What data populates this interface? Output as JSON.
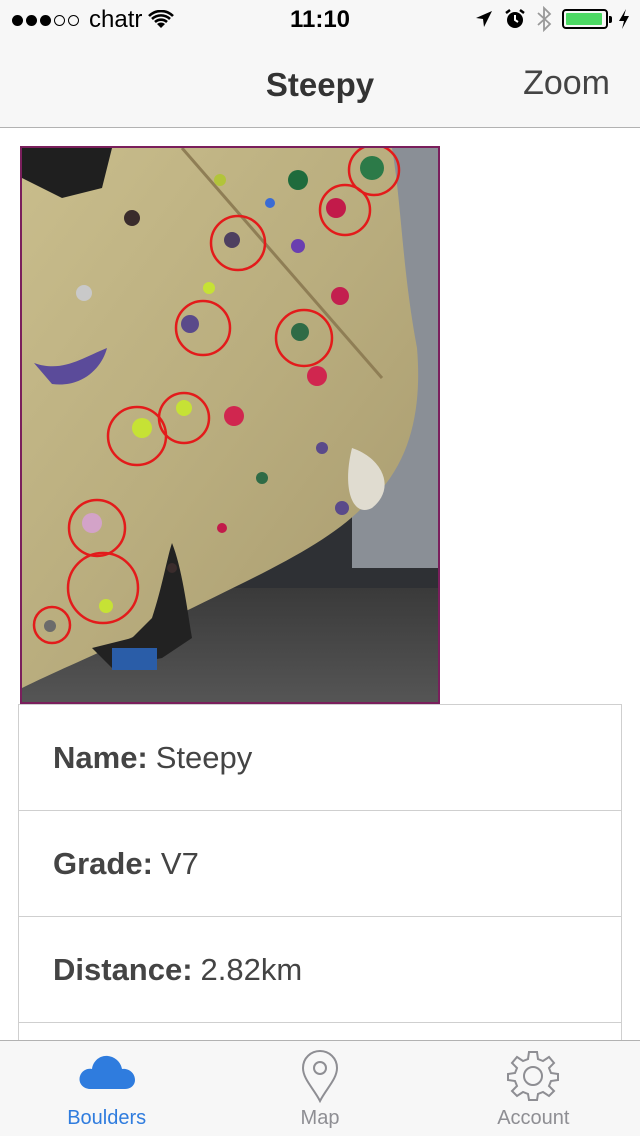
{
  "status_bar": {
    "signal_bars_filled": 3,
    "signal_bars_total": 5,
    "carrier": "chatr",
    "time": "11:10",
    "battery_level": 0.9,
    "icons": [
      "wifi-icon",
      "location-arrow-icon",
      "alarm-icon",
      "bluetooth-icon",
      "battery-icon",
      "charging-icon"
    ]
  },
  "navbar": {
    "title": "Steepy",
    "right_button": "Zoom"
  },
  "photo": {
    "description_icon": "boulder-wall-photo",
    "accent_circle_color": "#e31b1b",
    "frame_color": "#7a1f5c"
  },
  "details": {
    "name_label": "Name:",
    "name_value": "Steepy",
    "grade_label": "Grade:",
    "grade_value": "V7",
    "distance_label": "Distance:",
    "distance_value": "2.82km"
  },
  "tabbar": {
    "active_color": "#2f7cde",
    "inactive_color": "#8e8e93",
    "tabs": [
      {
        "label": "Boulders",
        "icon": "cloud-icon",
        "active": true
      },
      {
        "label": "Map",
        "icon": "map-pin-icon",
        "active": false
      },
      {
        "label": "Account",
        "icon": "gear-icon",
        "active": false
      }
    ]
  }
}
